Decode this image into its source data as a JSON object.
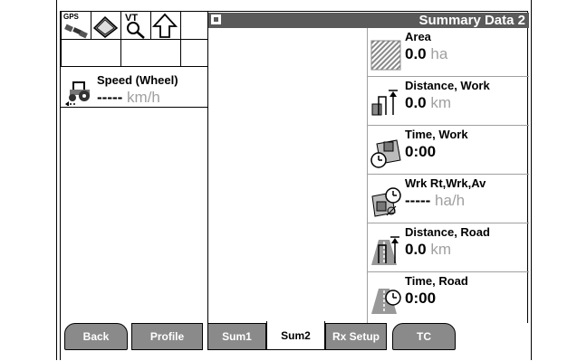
{
  "status_bar": {
    "gps_label": "GPS",
    "vt_label": "VT"
  },
  "speed": {
    "label": "Speed (Wheel)",
    "value": "-----",
    "unit": "km/h"
  },
  "title": "Summary Data 2",
  "tiles": [
    {
      "icon": "area-icon",
      "label": "Area",
      "value": "0.0",
      "unit": "ha"
    },
    {
      "icon": "distance-work-icon",
      "label": "Distance, Work",
      "value": "0.0",
      "unit": "km"
    },
    {
      "icon": "time-work-icon",
      "label": "Time, Work",
      "value": "0:00",
      "unit": ""
    },
    {
      "icon": "work-rate-icon",
      "label": "Wrk Rt,Wrk,Av",
      "value": "-----",
      "unit": "ha/h"
    },
    {
      "icon": "distance-road-icon",
      "label": "Distance, Road",
      "value": "0.0",
      "unit": "km"
    },
    {
      "icon": "time-road-icon",
      "label": "Time, Road",
      "value": "0:00",
      "unit": ""
    }
  ],
  "tabs": [
    {
      "label": "Back",
      "active": false
    },
    {
      "label": "Profile",
      "active": false
    },
    {
      "label": "Sum1",
      "active": false
    },
    {
      "label": "Sum2",
      "active": true
    },
    {
      "label": "Rx Setup",
      "active": false
    },
    {
      "label": "TC",
      "active": false
    }
  ],
  "colors": {
    "title_bar": "#5a5a5a",
    "tab_inactive": "#8a8a8a",
    "unit_gray": "#a0a0a0"
  }
}
